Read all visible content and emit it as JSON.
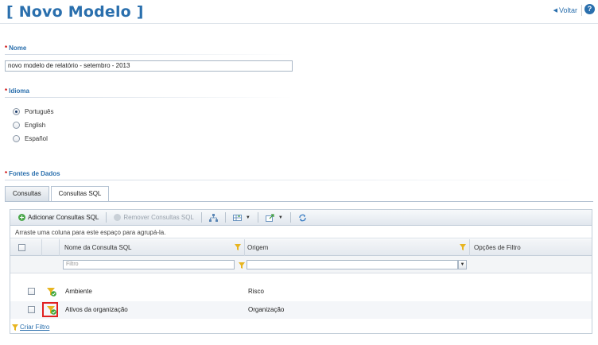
{
  "header": {
    "title": "[ Novo Modelo ]",
    "back_label": "Voltar",
    "help_label": "?"
  },
  "form": {
    "required_mark": "*",
    "name": {
      "label": "Nome",
      "value": "novo modelo de relatório - setembro - 2013"
    },
    "language": {
      "label": "Idioma",
      "options": [
        {
          "label": "Português",
          "selected": true
        },
        {
          "label": "English",
          "selected": false
        },
        {
          "label": "Español",
          "selected": false
        }
      ]
    },
    "data_sources": {
      "label": "Fontes de Dados"
    }
  },
  "tabs": [
    {
      "label": "Consultas",
      "active": false
    },
    {
      "label": "Consultas SQL",
      "active": true
    }
  ],
  "toolbar": {
    "add_label": "Adicionar Consultas SQL",
    "remove_label": "Remover Consultas SQL"
  },
  "grid": {
    "group_hint": "Arraste uma coluna para este espaço para agrupá-la.",
    "columns": {
      "name": "Nome da Consulta SQL",
      "origin": "Origem",
      "filter_options": "Opções de Filtro"
    },
    "filter_placeholder": "Filtro",
    "rows": [
      {
        "name": "Ambiente",
        "origin": "Risco"
      },
      {
        "name": "Ativos da organização",
        "origin": "Organização"
      }
    ],
    "create_filter_label": "Criar Filtro"
  },
  "colors": {
    "accent": "#2a6fad",
    "required": "#cc0000",
    "highlight": "#e02020"
  }
}
